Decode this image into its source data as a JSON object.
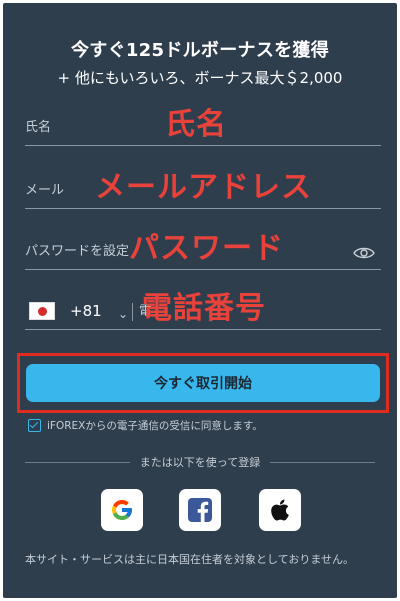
{
  "header": {
    "title": "今すぐ125ドルボーナスを獲得",
    "subtitle": "+ 他にもいろいろ、ボーナス最大＄2,000"
  },
  "form": {
    "name": {
      "placeholder": "氏名",
      "overlay": "氏名"
    },
    "email": {
      "placeholder": "メール",
      "overlay": "メールアドレス"
    },
    "password": {
      "placeholder": "パスワードを設定",
      "overlay": "パスワード"
    },
    "phone": {
      "country_code": "+81",
      "placeholder": "電",
      "overlay": "電話番号"
    }
  },
  "cta": {
    "label": "今すぐ取引開始"
  },
  "consent": {
    "checked": true,
    "text": "iFOREXからの電子通信の受信に同意します。"
  },
  "divider": {
    "text": "または以下を使って登録"
  },
  "social": [
    "google-icon",
    "facebook-icon",
    "apple-icon"
  ],
  "footer": {
    "text": "本サイト・サービスは主に日本国在住者を対象としておりません。"
  },
  "colors": {
    "panel_bg": "#2f3e4d",
    "accent": "#37b7ec",
    "annotation_red": "#e8423a"
  }
}
